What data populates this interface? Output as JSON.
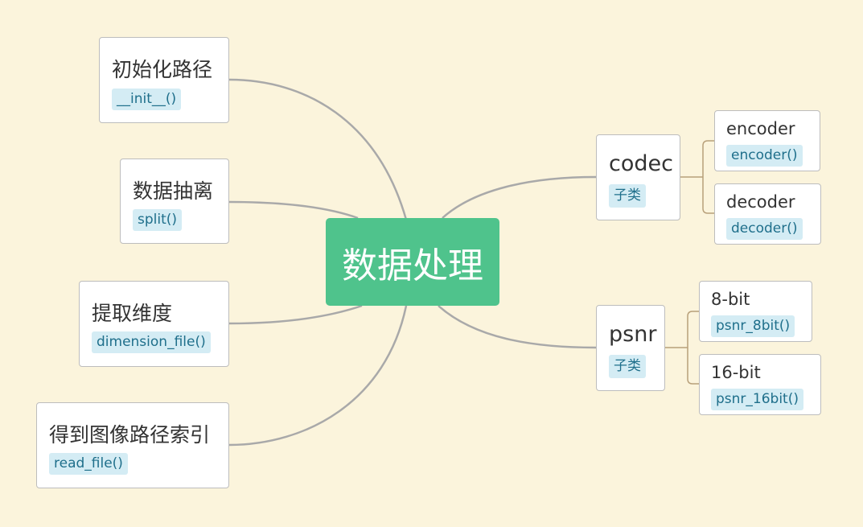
{
  "root": {
    "label": "数据处理"
  },
  "left_nodes": [
    {
      "title": "初始化路径",
      "tag": "__init__()"
    },
    {
      "title": "数据抽离",
      "tag": "split()"
    },
    {
      "title": "提取维度",
      "tag": "dimension_file()"
    },
    {
      "title": "得到图像路径索引",
      "tag": "read_file()"
    }
  ],
  "right_nodes": [
    {
      "title": "codec",
      "tag": "子类",
      "children": [
        {
          "title": "encoder",
          "tag": "encoder()"
        },
        {
          "title": "decoder",
          "tag": "decoder()"
        }
      ]
    },
    {
      "title": "psnr",
      "tag": "子类",
      "children": [
        {
          "title": "8-bit",
          "tag": "psnr_8bit()"
        },
        {
          "title": "16-bit",
          "tag": "psnr_16bit()"
        }
      ]
    }
  ],
  "colors": {
    "background": "#fbf4dc",
    "root_fill": "#4fc38c",
    "tag_fill": "#d4ecf4",
    "tag_text": "#1f6f8b",
    "connector": "#a9a9a9",
    "child_connector": "#b8a07a"
  }
}
